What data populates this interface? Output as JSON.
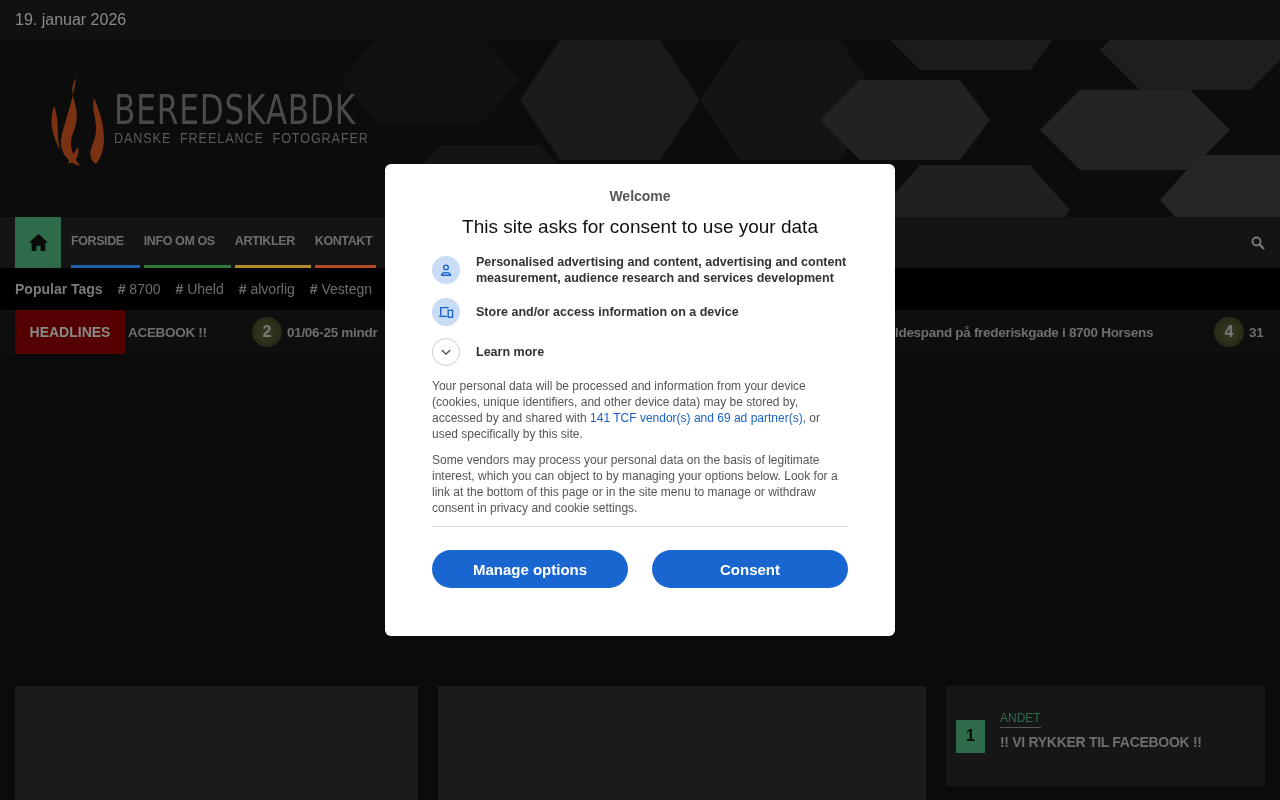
{
  "date": "19. januar 2026",
  "logo": {
    "title": "BEREDSKABDK",
    "subtitle": "DANSKE  FREELANCE  FOTOGRAFER"
  },
  "nav": {
    "items": [
      {
        "kind": "home",
        "selected": true,
        "color": "#2e6b4a"
      },
      {
        "kind": "link",
        "label": "FORSIDE",
        "selected": false,
        "color": "#1d5fa8"
      },
      {
        "kind": "link",
        "label": "INFO OM OS",
        "selected": false,
        "color": "#2f7a3a"
      },
      {
        "kind": "link",
        "label": "ARTIKLER",
        "selected": false,
        "color": "#b08a2a"
      },
      {
        "kind": "link",
        "label": "KONTAKT",
        "selected": false,
        "color": "#b04a22"
      }
    ]
  },
  "tags": {
    "label": "Popular Tags",
    "items": [
      {
        "hash": "#",
        "text": "8700"
      },
      {
        "hash": "#",
        "text": "Uheld"
      },
      {
        "hash": "#",
        "text": "alvorlig"
      },
      {
        "hash": "#",
        "text": "Vestegn"
      }
    ]
  },
  "headlines": {
    "label": "HEADLINES",
    "items": [
      {
        "kind": "text",
        "title": "ACEBOOK !!"
      },
      {
        "kind": "numbered",
        "number": "2",
        "title": "01/06-25 mindr"
      },
      {
        "kind": "text",
        "title": "ldespand på frederiskgade i 8700 Horsens"
      },
      {
        "kind": "numbered",
        "number": "4",
        "title": "31"
      }
    ]
  },
  "consent": {
    "welcome": "Welcome",
    "title": "This site asks for consent to use your data",
    "purposes": [
      {
        "kind": "person",
        "text": "Personalised advertising and content, advertising and content measurement, audience research and services development"
      },
      {
        "kind": "device",
        "text": "Store and/or access information on a device"
      },
      {
        "kind": "expand",
        "text": "Learn more"
      }
    ],
    "paragraph_1": {
      "before": "Your personal data will be processed and information from your device (cookies, unique identifiers, and other device data) may be stored by, accessed by and shared with ",
      "link": "141 TCF vendor(s) and 69 ad partner(s)",
      "after": ", or used specifically by this site."
    },
    "paragraph_2": "Some vendors may process your personal data on the basis of legitimate interest, which you can object to by managing your options below. Look for a link at the bottom of this page or in the site menu to manage or withdraw consent in privacy and cookie settings.",
    "buttons": [
      "Manage options",
      "Consent"
    ]
  },
  "sidebar": {
    "number": "1",
    "category": "ANDET",
    "title": "!! VI RYKKER TIL FACEBOOK !!"
  }
}
